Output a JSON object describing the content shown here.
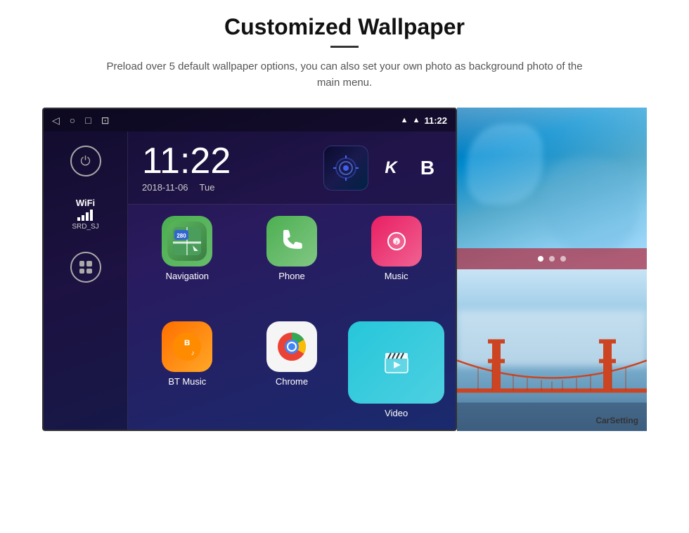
{
  "header": {
    "title": "Customized Wallpaper",
    "description": "Preload over 5 default wallpaper options, you can also set your own photo as background photo of the main menu."
  },
  "android": {
    "statusBar": {
      "time": "11:22",
      "navIcons": [
        "◁",
        "○",
        "□",
        "⊡"
      ]
    },
    "clock": {
      "time": "11:22",
      "date": "2018-11-06",
      "day": "Tue"
    },
    "sidebar": {
      "wifiLabel": "WiFi",
      "wifiNetwork": "SRD_SJ"
    },
    "apps": [
      {
        "name": "Navigation",
        "type": "navigation"
      },
      {
        "name": "Phone",
        "type": "phone"
      },
      {
        "name": "Music",
        "type": "music"
      },
      {
        "name": "BT Music",
        "type": "btmusic"
      },
      {
        "name": "Chrome",
        "type": "chrome"
      },
      {
        "name": "Video",
        "type": "video"
      }
    ]
  },
  "wallpapers": [
    {
      "name": "ice-cave",
      "label": ""
    },
    {
      "name": "golden-gate",
      "label": "CarSetting"
    }
  ]
}
